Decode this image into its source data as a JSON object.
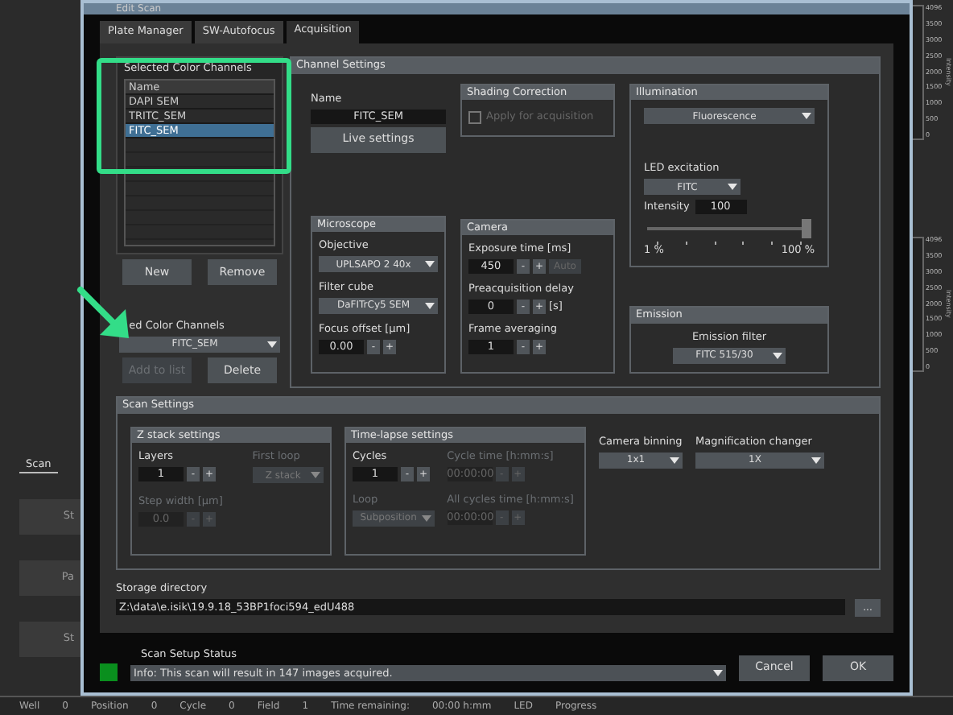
{
  "background_app": {
    "side_tab": "Scan",
    "side_buttons": [
      "St",
      "Pa",
      "St"
    ],
    "histograms": [
      {
        "ticks": [
          "4096",
          "3500",
          "3000",
          "2500",
          "2000",
          "1500",
          "1000",
          "500",
          "0"
        ],
        "axis_label": "Intensity"
      },
      {
        "ticks": [
          "4096",
          "3500",
          "3000",
          "2500",
          "2000",
          "1500",
          "1000",
          "500",
          "0"
        ],
        "axis_label": "Intensity"
      }
    ],
    "status_bar": [
      {
        "label": "Well",
        "value": "0"
      },
      {
        "label": "Position",
        "value": "0"
      },
      {
        "label": "Cycle",
        "value": "0"
      },
      {
        "label": "Field",
        "value": "1"
      },
      {
        "label": "Time remaining:",
        "value": "00:00 h:mm"
      },
      {
        "label": "LED"
      },
      {
        "label": "Progress"
      }
    ]
  },
  "dialog": {
    "title": "Edit Scan",
    "tabs": [
      {
        "label": "Plate Manager",
        "selected": false
      },
      {
        "label": "SW-Autofocus",
        "selected": false
      },
      {
        "label": "Acquisition",
        "selected": true
      }
    ],
    "selected_channels": {
      "title": "Selected Color Channels",
      "column": "Name",
      "rows": [
        {
          "name": "DAPI SEM",
          "selected": false
        },
        {
          "name": "TRITC_SEM",
          "selected": false
        },
        {
          "name": "FITC_SEM",
          "selected": true
        }
      ]
    },
    "channel_buttons": [
      {
        "label": "New",
        "disabled": false
      },
      {
        "label": "Remove",
        "disabled": false
      }
    ],
    "saved_channels": {
      "label": "ed Color Channels",
      "value": "FITC_SEM"
    },
    "saved_buttons": [
      {
        "label": "Add to list",
        "disabled": true
      },
      {
        "label": "Delete",
        "disabled": false
      }
    ],
    "channel_settings": {
      "title": "Channel Settings",
      "name_label": "Name",
      "name_value": "FITC_SEM",
      "live_button": "Live settings",
      "shading": {
        "title": "Shading Correction",
        "checkbox": {
          "label": "Apply for acquisition",
          "checked": false,
          "disabled": true
        }
      },
      "microscope": {
        "title": "Microscope",
        "fields": [
          {
            "kind": "dropdown",
            "label": "Objective",
            "value": "UPLSAPO 2 40x",
            "disabled": false
          },
          {
            "kind": "dropdown",
            "label": "Filter cube",
            "value": "DaFITrCy5 SEM",
            "disabled": false
          },
          {
            "kind": "spin",
            "label": "Focus offset [µm]",
            "value": "0.00",
            "buttons": [
              "-",
              "+"
            ],
            "disabled": false
          }
        ]
      },
      "camera": {
        "title": "Camera",
        "fields": [
          {
            "kind": "spin",
            "label": "Exposure time [ms]",
            "value": "450",
            "buttons": [
              "-",
              "+"
            ],
            "disabled": false,
            "extra": {
              "label": "Auto",
              "disabled": true
            }
          },
          {
            "kind": "spin",
            "label": "Preacquisition delay",
            "value": "0",
            "buttons": [
              "-",
              "+"
            ],
            "disabled": false,
            "unit": "[s]"
          },
          {
            "kind": "spin",
            "label": "Frame averaging",
            "value": "1",
            "buttons": [
              "-",
              "+"
            ],
            "disabled": false
          }
        ]
      },
      "illumination": {
        "title": "Illumination",
        "mode": "Fluorescence",
        "led_label": "LED excitation",
        "led_value": "FITC",
        "intensity_label": "Intensity",
        "intensity_value": "100",
        "level": 1.0,
        "min_label": "1 %",
        "max_label": "100 %"
      },
      "emission": {
        "title": "Emission",
        "filter_label": "Emission filter",
        "filter_value": "FITC 515/30"
      }
    },
    "scan_settings": {
      "title": "Scan Settings",
      "groups": [
        {
          "title": "Z stack settings",
          "fields": [
            {
              "kind": "spin",
              "label": "Layers",
              "value": "1",
              "buttons": [
                "-",
                "+"
              ],
              "disabled": false
            },
            {
              "kind": "dropdown",
              "label": "First loop",
              "value": "Z stack",
              "disabled": true
            },
            {
              "kind": "spin",
              "label": "Step width [µm]",
              "value": "0.0",
              "buttons": [
                "-",
                "+"
              ],
              "disabled": true
            }
          ]
        },
        {
          "title": "Time-lapse settings",
          "fields": [
            {
              "kind": "spin",
              "label": "Cycles",
              "value": "1",
              "buttons": [
                "-",
                "+"
              ],
              "disabled": false
            },
            {
              "kind": "spin",
              "label": "Cycle time [h:mm:s]",
              "value": "00:00:00",
              "buttons": [
                "-",
                "+"
              ],
              "disabled": true
            },
            {
              "kind": "dropdown",
              "label": "Loop",
              "value": "Subposition",
              "disabled": true
            },
            {
              "kind": "spin",
              "label": "All cycles time [h:mm:s]",
              "value": "00:00:00",
              "buttons": [
                "-",
                "+"
              ],
              "disabled": true
            }
          ]
        }
      ],
      "extras": [
        {
          "kind": "dropdown",
          "label": "Camera binning",
          "value": "1x1",
          "disabled": false
        },
        {
          "kind": "dropdown",
          "label": "Magnification changer",
          "value": "1X",
          "disabled": false
        }
      ]
    },
    "storage": {
      "label": "Storage directory",
      "path": "Z:\\data\\e.isik\\19.9.18_53BP1foci594_edU488",
      "browse": "..."
    },
    "status": {
      "label": "Scan Setup Status",
      "color": "#0a8f1e",
      "message": "Info: This scan will result in 147 images acquired."
    },
    "footer_buttons": [
      "Cancel",
      "OK"
    ]
  }
}
